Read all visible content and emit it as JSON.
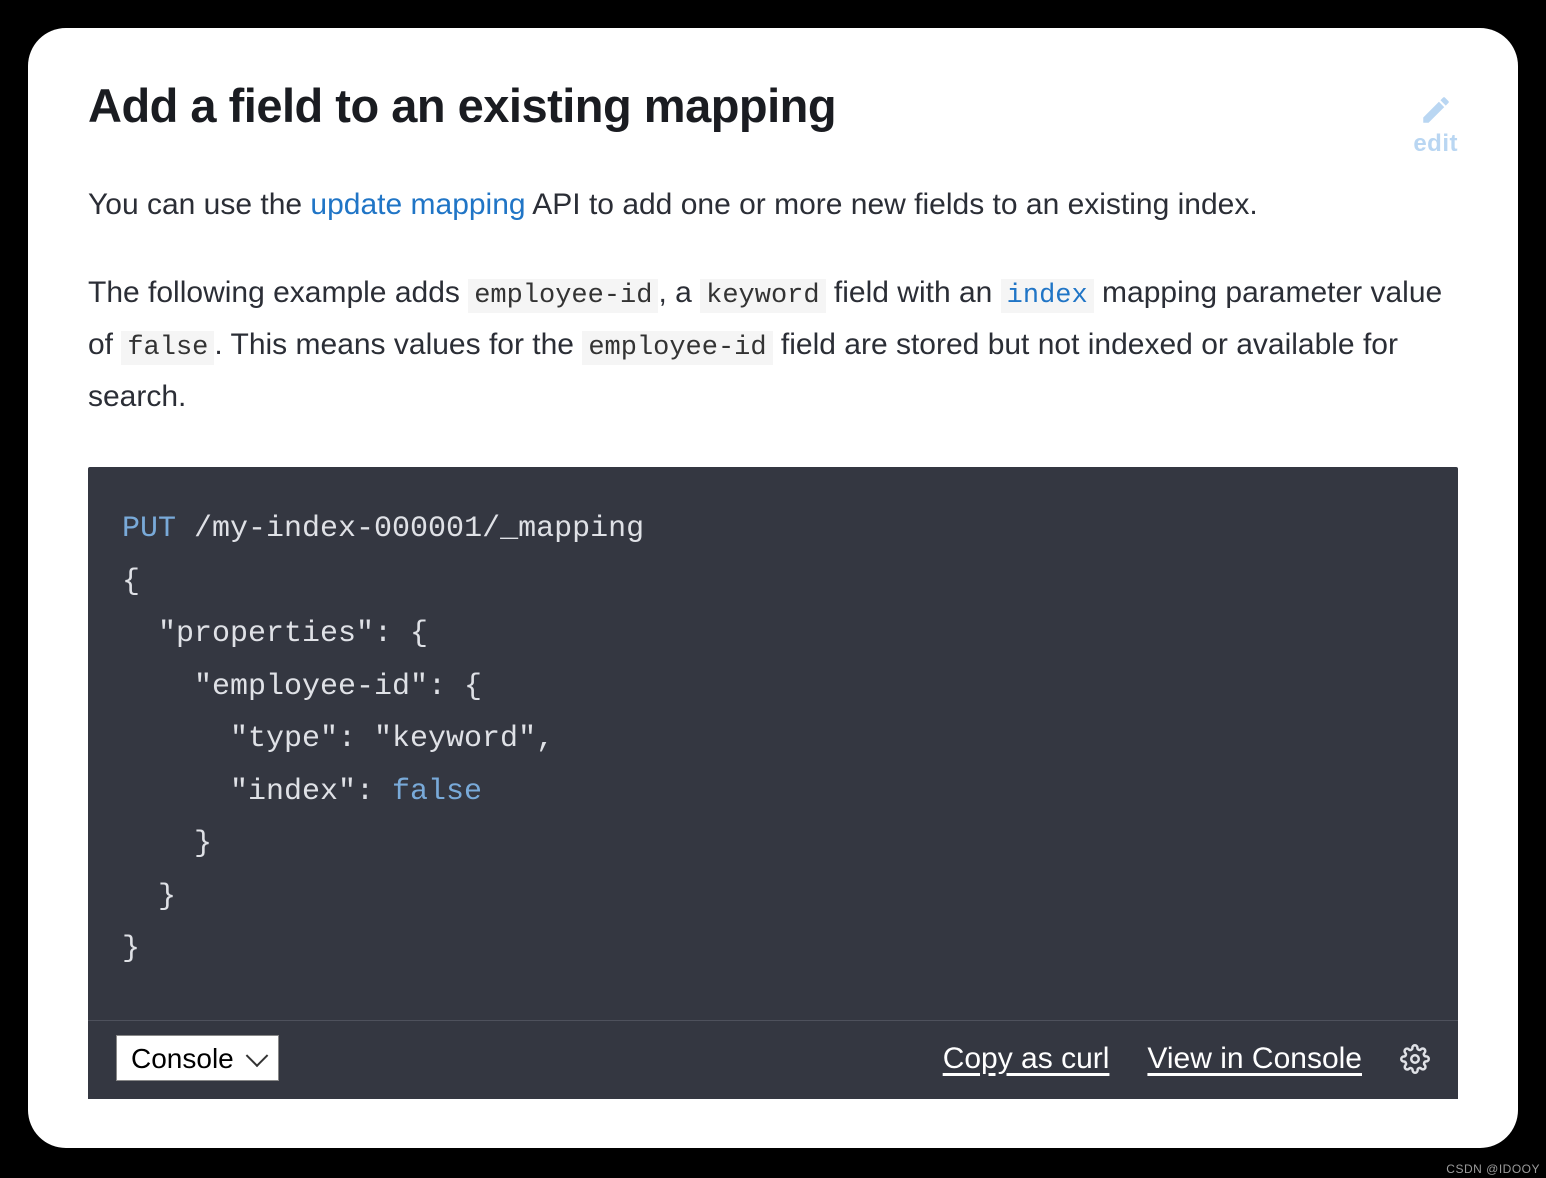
{
  "heading": "Add a field to an existing mapping",
  "edit_label": "edit",
  "para1": {
    "prefix": "You can use the ",
    "link_text": "update mapping",
    "suffix": " API to add one or more new fields to an existing index."
  },
  "para2": {
    "t0": "The following example adds ",
    "code0": "employee-id",
    "t1": ", a ",
    "code1": "keyword",
    "t2": " field with an ",
    "code2_link": "index",
    "t3": " mapping parameter value of ",
    "code3": "false",
    "t4": ". This means values for the ",
    "code4": "employee-id",
    "t5": " field are stored but not indexed or available for search."
  },
  "code": {
    "method": "PUT",
    "path": " /my-index-000001/_mapping",
    "l2": "{",
    "l3": "  \"properties\": {",
    "l4": "    \"employee-id\": {",
    "l5": "      \"type\": \"keyword\",",
    "l6a": "      \"index\": ",
    "l6b": "false",
    "l7": "    }",
    "l8": "  }",
    "l9": "}"
  },
  "footer": {
    "select_value": "Console",
    "copy": "Copy as curl",
    "view": "View in Console"
  },
  "watermark": "CSDN @IDOOY"
}
